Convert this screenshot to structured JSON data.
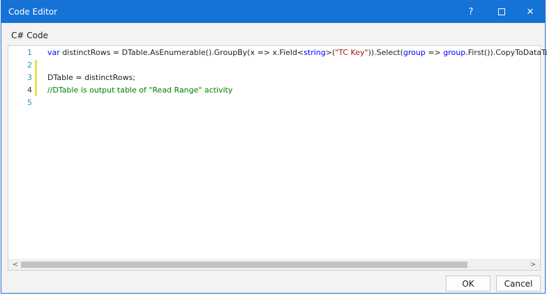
{
  "window": {
    "title": "Code Editor",
    "help_label": "?",
    "close_label": "✕"
  },
  "section": {
    "label": "C# Code"
  },
  "editor": {
    "line_numbers": [
      "1",
      "2",
      "3",
      "4",
      "5"
    ],
    "lines": [
      [
        {
          "t": "var",
          "c": "kw"
        },
        {
          "t": " distinctRows = DTable.AsEnumerable().GroupBy(x => x.Field<",
          "c": ""
        },
        {
          "t": "string",
          "c": "kw"
        },
        {
          "t": ">(",
          "c": ""
        },
        {
          "t": "\"TC Key\"",
          "c": "str"
        },
        {
          "t": ")).Select(",
          "c": ""
        },
        {
          "t": "group",
          "c": "kw"
        },
        {
          "t": " => ",
          "c": ""
        },
        {
          "t": "group",
          "c": "kw"
        },
        {
          "t": ".First()).CopyToDataTable();",
          "c": ""
        }
      ],
      [],
      [
        {
          "t": "DTable = distinctRows;",
          "c": ""
        }
      ],
      [
        {
          "t": "//DTable is output table of \"Read Range\" activity",
          "c": "cm"
        }
      ],
      []
    ]
  },
  "scrollbar": {
    "left_arrow": "<",
    "right_arrow": ">"
  },
  "buttons": {
    "ok": "OK",
    "cancel": "Cancel"
  }
}
